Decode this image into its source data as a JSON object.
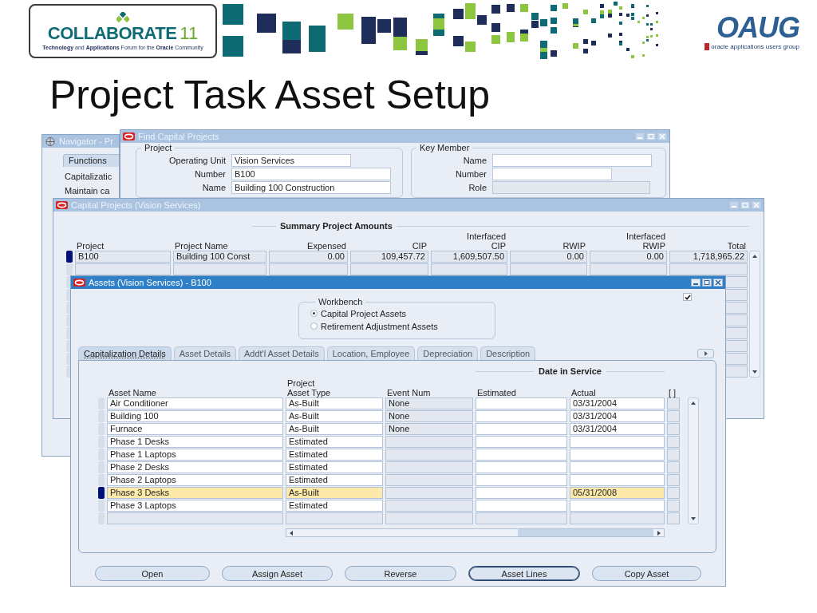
{
  "header": {
    "logo_left": {
      "name": "COLLABORATE",
      "number": "11",
      "tagline": "**Technology** and **Applications** Forum for the **Oracle** Community"
    },
    "logo_right": {
      "name": "OAUG",
      "tagline": "oracle applications users group"
    },
    "title": "Project Task Asset Setup"
  },
  "navigator": {
    "title": "Navigator - Pr",
    "tabs": [
      {
        "label": "Functions",
        "selected": true
      }
    ],
    "items": [
      "Capitalizatic",
      "Maintain ca"
    ]
  },
  "find_window": {
    "title": "Find Capital Projects",
    "groups": [
      {
        "title": "Project",
        "fields": [
          {
            "label": "Operating Unit",
            "value": "Vision Services",
            "kind": "short"
          },
          {
            "label": "Number",
            "value": "B100",
            "kind": "long"
          },
          {
            "label": "Name",
            "value": "Building 100 Construction",
            "kind": "long"
          }
        ]
      },
      {
        "title": "Key Member",
        "fields": [
          {
            "label": "Name",
            "kind": "long"
          },
          {
            "label": "Number",
            "kind": "short"
          },
          {
            "label": "Role",
            "kind": "disabled"
          }
        ]
      }
    ]
  },
  "capital_projects": {
    "title": "Capital Projects (Vision Services)",
    "heading": "Summary Project Amounts",
    "columns": [
      {
        "label": "Project",
        "kind": "text"
      },
      {
        "label": "Project Name",
        "kind": "text"
      },
      {
        "label": "Expensed",
        "kind": "amount"
      },
      {
        "label": "CIP",
        "kind": "amount"
      },
      {
        "top": "Interfaced",
        "label": "CIP",
        "kind": "amount"
      },
      {
        "label": "RWIP",
        "kind": "amount"
      },
      {
        "top": "Interfaced",
        "label": "RWIP",
        "kind": "amount"
      },
      {
        "label": "Total",
        "kind": "amount"
      }
    ],
    "rows": [
      {
        "selected": true,
        "cells": [
          "B100",
          "Building 100 Const",
          "0.00",
          "109,457.72",
          "1,609,507.50",
          "0.00",
          "0.00",
          "1,718,965.22"
        ]
      }
    ]
  },
  "assets": {
    "title": "Assets (Vision Services) - B100",
    "checkbox": {
      "checked": true
    },
    "workbench": {
      "title": "Workbench",
      "options": [
        {
          "label": "Capital Project Assets",
          "selected": true
        },
        {
          "label": "Retirement Adjustment Assets",
          "selected": false
        }
      ]
    },
    "tabs": [
      {
        "label": "Capitalization Details",
        "selected": true
      },
      {
        "label": "Asset Details",
        "selected": false
      },
      {
        "label": "Addt'l Asset Details",
        "selected": false
      },
      {
        "label": "Location, Employee",
        "selected": false
      },
      {
        "label": "Depreciation",
        "selected": false
      },
      {
        "label": "Description",
        "selected": false
      }
    ],
    "table": {
      "group_heading": "Date in Service",
      "columns": [
        {
          "label": "Asset Name"
        },
        {
          "top": "Project",
          "label": "Asset Type"
        },
        {
          "label": "Event Num"
        },
        {
          "label": "Estimated"
        },
        {
          "label": "Actual"
        },
        {
          "label": "[ ]"
        }
      ],
      "rows": [
        {
          "name": "Air Conditioner",
          "type": "As-Built",
          "event": "None",
          "actual": "03/31/2004",
          "selected": false
        },
        {
          "name": "Building 100",
          "type": "As-Built",
          "event": "None",
          "actual": "03/31/2004",
          "selected": false
        },
        {
          "name": "Furnace",
          "type": "As-Built",
          "event": "None",
          "actual": "03/31/2004",
          "selected": false
        },
        {
          "name": "Phase 1 Desks",
          "type": "Estimated",
          "selected": false
        },
        {
          "name": "Phase 1 Laptops",
          "type": "Estimated",
          "selected": false
        },
        {
          "name": "Phase 2 Desks",
          "type": "Estimated",
          "selected": false
        },
        {
          "name": "Phase 2 Laptops",
          "type": "Estimated",
          "selected": false
        },
        {
          "name": "Phase 3 Desks",
          "type": "As-Built",
          "actual": "05/31/2008",
          "selected": true
        },
        {
          "name": "Phase 3 Laptops",
          "type": "Estimated",
          "selected": false
        }
      ]
    },
    "buttons": [
      {
        "label": "Open",
        "focused": false
      },
      {
        "label": "Assign Asset",
        "focused": false
      },
      {
        "label": "Reverse",
        "focused": false
      },
      {
        "label": "Asset Lines",
        "focused": true
      },
      {
        "label": "Copy Asset",
        "focused": false
      }
    ]
  }
}
